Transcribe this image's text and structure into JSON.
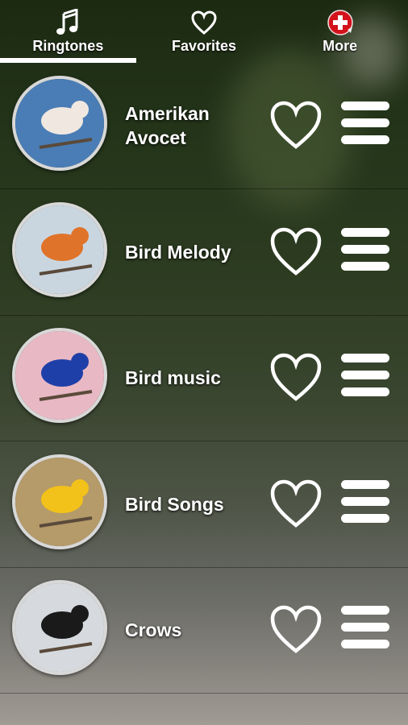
{
  "tabs": [
    {
      "label": "Ringtones",
      "icon": "music-note-icon",
      "active": true
    },
    {
      "label": "Favorites",
      "icon": "heart-outline-icon",
      "active": false
    },
    {
      "label": "More",
      "icon": "red-plus-badge-icon",
      "active": false
    }
  ],
  "colors": {
    "accent": "#ffffff",
    "more_badge": "#d3121c"
  },
  "ringtones": [
    {
      "name": "Amerikan Avocet",
      "image": "avocet",
      "bg": "#4a7db5",
      "bird": "#f0e8e0"
    },
    {
      "name": "Bird Melody",
      "image": "robin",
      "bg": "#c9d6e0",
      "bird": "#e0732a"
    },
    {
      "name": "Bird music",
      "image": "blue-bird",
      "bg": "#e8b8c4",
      "bird": "#1f3fa8"
    },
    {
      "name": "Bird Songs",
      "image": "yellow-bird",
      "bg": "#b59a6a",
      "bird": "#f2c21a"
    },
    {
      "name": "Crows",
      "image": "crow",
      "bg": "#d6dade",
      "bird": "#1a1a1a"
    }
  ]
}
